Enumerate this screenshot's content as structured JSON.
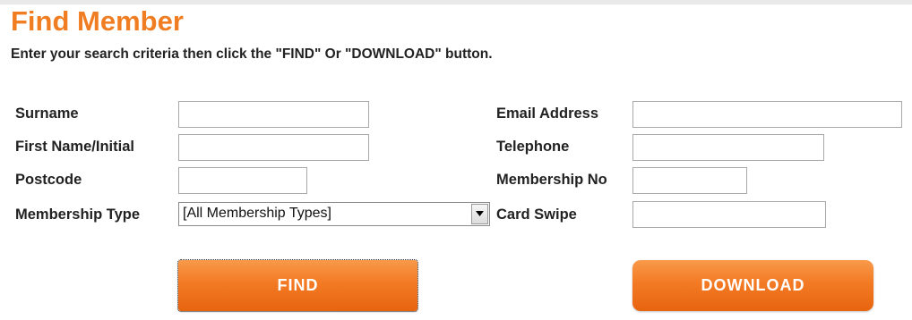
{
  "page": {
    "title": "Find Member",
    "instructions": "Enter your search criteria then click the \"FIND\" Or \"DOWNLOAD\" button.",
    "accent_color": "#f07d22"
  },
  "form": {
    "left": {
      "surname": {
        "label": "Surname",
        "value": ""
      },
      "first_name": {
        "label": "First Name/Initial",
        "value": ""
      },
      "postcode": {
        "label": "Postcode",
        "value": ""
      },
      "membership_type": {
        "label": "Membership Type",
        "selected": "[All Membership Types]"
      }
    },
    "right": {
      "email": {
        "label": "Email Address",
        "value": ""
      },
      "telephone": {
        "label": "Telephone",
        "value": ""
      },
      "membership_no": {
        "label": "Membership No",
        "value": ""
      },
      "card_swipe": {
        "label": "Card Swipe",
        "value": ""
      }
    }
  },
  "actions": {
    "find_label": "FIND",
    "download_label": "DOWNLOAD"
  }
}
